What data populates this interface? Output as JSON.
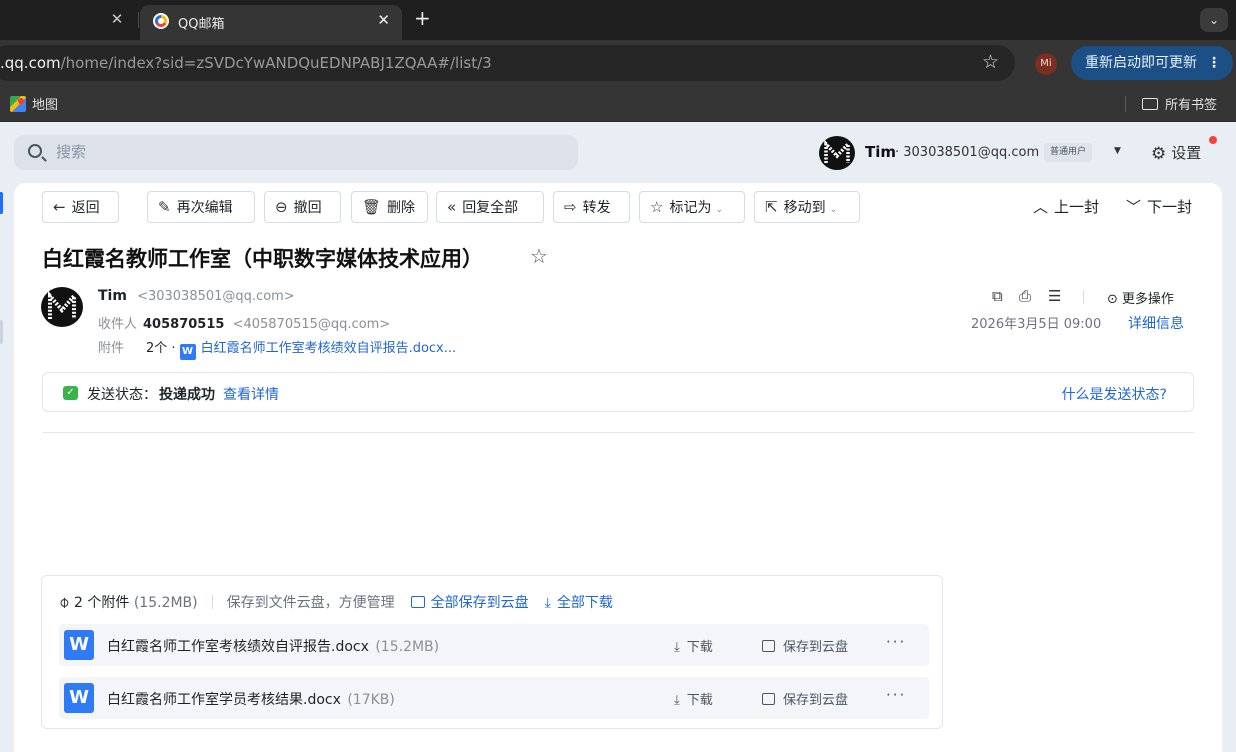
{
  "browser": {
    "tab_title": "QQ邮箱",
    "url_host": ".qq.com",
    "url_path": "/home/index?sid=zSVDcYwANDQuEDNPABJ1ZQAA#/list/3",
    "profile_initials": "Mi",
    "update_label": "重新启动即可更新",
    "bookmark_maps": "地图",
    "bookmark_all": "所有书签"
  },
  "header": {
    "search_placeholder": "搜索",
    "user_name": "Tim",
    "user_email": "· 303038501@qq.com",
    "user_badge": "普通用户",
    "settings_label": "设置"
  },
  "toolbar": {
    "back": "返回",
    "reedit": "再次编辑",
    "recall": "撤回",
    "delete": "删除",
    "reply_all": "回复全部",
    "forward": "转发",
    "mark_as": "标记为",
    "move_to": "移动到",
    "prev": "上一封",
    "next": "下一封"
  },
  "mail": {
    "subject": "白红霞名教师工作室（中职数字媒体技术应用）",
    "sender_name": "Tim",
    "sender_email": "<303038501@qq.com>",
    "recipient_label": "收件人",
    "recipient_name": "405870515",
    "recipient_email": "<405870515@qq.com>",
    "attach_label": "附件",
    "attach_count": "2个 ·",
    "attach_first": "白红霞名师工作室考核绩效自评报告.docx...",
    "more_ops": "更多操作",
    "datetime": "2026年3月5日 09:00",
    "details_link": "详细信息",
    "status_label": "发送状态：",
    "status_value": "投递成功",
    "status_detail": "查看详情",
    "status_help": "什么是发送状态?"
  },
  "attachments": {
    "count_label": "2 个附件",
    "total_size": "(15.2MB)",
    "hint": "保存到文件云盘，方便管理",
    "save_all": "全部保存到云盘",
    "download_all": "全部下载",
    "download_label": "下载",
    "save_label": "保存到云盘",
    "files": [
      {
        "name": "白红霞名师工作室考核绩效自评报告.docx",
        "size": "(15.2MB)"
      },
      {
        "name": "白红霞名师工作室学员考核结果.docx",
        "size": "(17KB)"
      }
    ]
  },
  "colors": {
    "accent": "#1f66d9",
    "success": "#3bb34a",
    "word": "#2f7bf6"
  }
}
